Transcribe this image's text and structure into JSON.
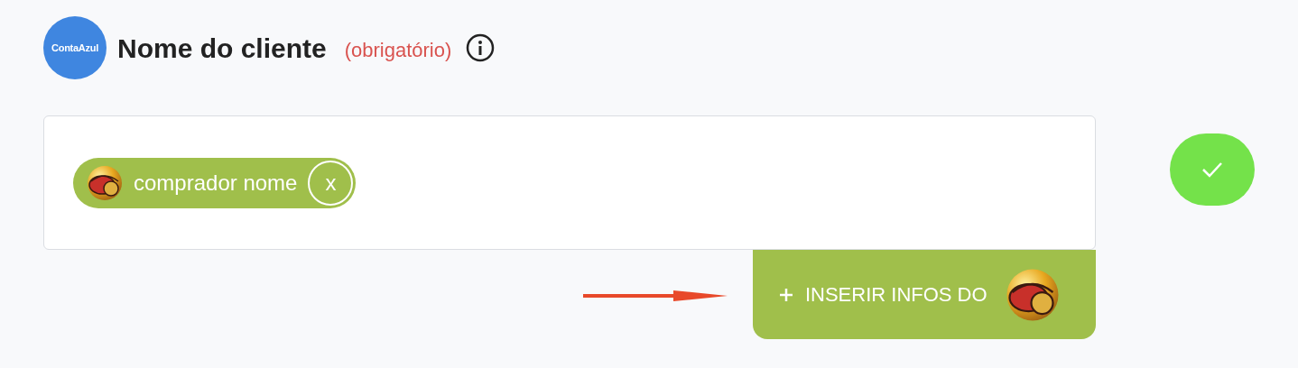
{
  "header": {
    "logo_text": "ContaAzul",
    "title": "Nome do cliente",
    "required_label": "(obrigatório)"
  },
  "field": {
    "chips": [
      {
        "label": "comprador nome",
        "remove": "x"
      }
    ]
  },
  "insert_button": {
    "label": "INSERIR INFOS DO"
  }
}
